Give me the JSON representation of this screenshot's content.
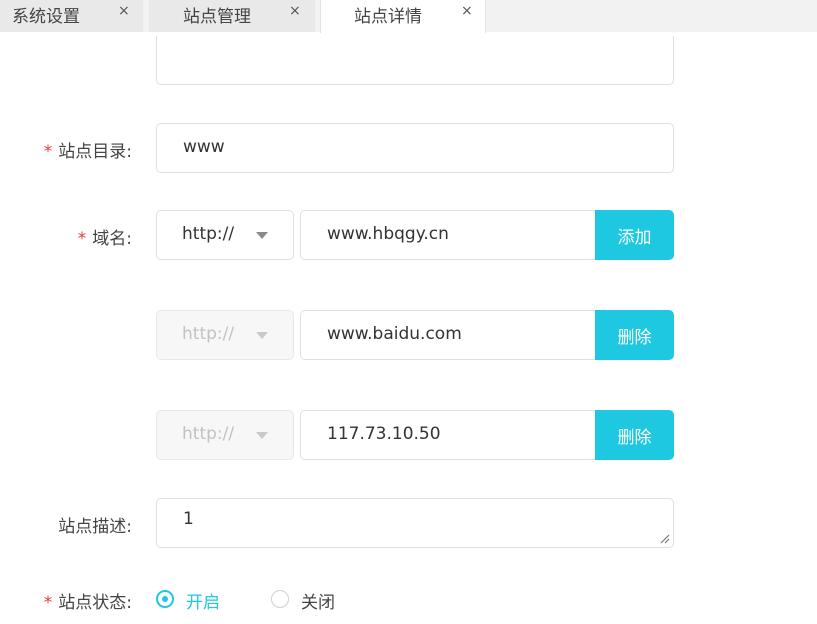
{
  "tabs": [
    {
      "label": "系统设置",
      "close": "×"
    },
    {
      "label": "站点管理",
      "close": "×"
    },
    {
      "label": "站点详情",
      "close": "×"
    }
  ],
  "form": {
    "required_mark": "*",
    "site_dir": {
      "label": "站点目录:",
      "value": "www"
    },
    "domain": {
      "label": "域名:",
      "rows": [
        {
          "protocol": "http://",
          "value": "www.hbqgy.cn",
          "action": "添加"
        },
        {
          "protocol": "http://",
          "value": "www.baidu.com",
          "action": "删除"
        },
        {
          "protocol": "http://",
          "value": "117.73.10.50",
          "action": "删除"
        }
      ]
    },
    "site_desc": {
      "label": "站点描述:",
      "value": "1"
    },
    "site_status": {
      "label": "站点状态:",
      "options": [
        {
          "label": "开启",
          "selected": true
        },
        {
          "label": "关闭",
          "selected": false
        }
      ]
    }
  },
  "colors": {
    "accent": "#1fc8e1",
    "required": "#e63a3a"
  }
}
